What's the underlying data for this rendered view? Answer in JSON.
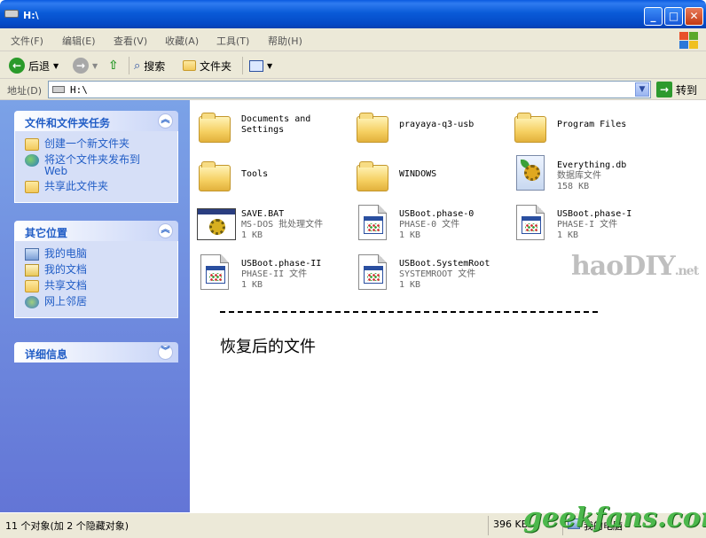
{
  "window": {
    "title": "H:\\"
  },
  "menu": [
    "文件(F)",
    "编辑(E)",
    "查看(V)",
    "收藏(A)",
    "工具(T)",
    "帮助(H)"
  ],
  "toolbar": {
    "back": "后退",
    "search": "搜索",
    "folders": "文件夹"
  },
  "address": {
    "label": "地址(D)",
    "value": "H:\\",
    "go": "转到"
  },
  "left_panels": {
    "tasks": {
      "title": "文件和文件夹任务",
      "items": [
        {
          "lines": [
            "创建一个新文件夹"
          ],
          "icon": "new-folder-icon"
        },
        {
          "lines": [
            "将这个文件夹发布到",
            "Web"
          ],
          "icon": "publish-web-icon"
        },
        {
          "lines": [
            "共享此文件夹"
          ],
          "icon": "share-folder-icon"
        }
      ]
    },
    "other": {
      "title": "其它位置",
      "items": [
        {
          "lines": [
            "我的电脑"
          ],
          "icon": "my-computer-icon"
        },
        {
          "lines": [
            "我的文档"
          ],
          "icon": "my-documents-icon"
        },
        {
          "lines": [
            "共享文档"
          ],
          "icon": "shared-documents-icon"
        },
        {
          "lines": [
            "网上邻居"
          ],
          "icon": "network-places-icon"
        }
      ]
    },
    "details": {
      "title": "详细信息"
    }
  },
  "files": [
    {
      "name": "Documents and",
      "name2": "Settings",
      "type": "folder"
    },
    {
      "name": "prayaya-q3-usb",
      "type": "folder"
    },
    {
      "name": "Program Files",
      "type": "folder"
    },
    {
      "name": "Tools",
      "type": "folder"
    },
    {
      "name": "WINDOWS",
      "type": "folder"
    },
    {
      "name": "Everything.db",
      "desc": "数据库文件",
      "size": "158 KB",
      "type": "db"
    },
    {
      "name": "SAVE.BAT",
      "desc": "MS-DOS 批处理文件",
      "size": "1 KB",
      "type": "bat"
    },
    {
      "name": "USBoot.phase-0",
      "desc": "PHASE-0 文件",
      "size": "1 KB",
      "type": "doc"
    },
    {
      "name": "USBoot.phase-I",
      "desc": "PHASE-I 文件",
      "size": "1 KB",
      "type": "doc"
    },
    {
      "name": "USBoot.phase-II",
      "desc": "PHASE-II 文件",
      "size": "1 KB",
      "type": "doc"
    },
    {
      "name": "USBoot.SystemRoot",
      "desc": "SYSTEMROOT 文件",
      "size": "1 KB",
      "type": "doc"
    }
  ],
  "annotation": {
    "dashes": "------------------------------------------------------------",
    "text": "恢复后的文件"
  },
  "watermarks": {
    "haodiy": "haoDIY",
    "haodiy_suffix": ".net",
    "geekfans": "geekfans.com"
  },
  "status": {
    "objects": "11 个对象(加 2 个隐藏对象)",
    "size": "396 KB",
    "location": "我的电脑"
  }
}
